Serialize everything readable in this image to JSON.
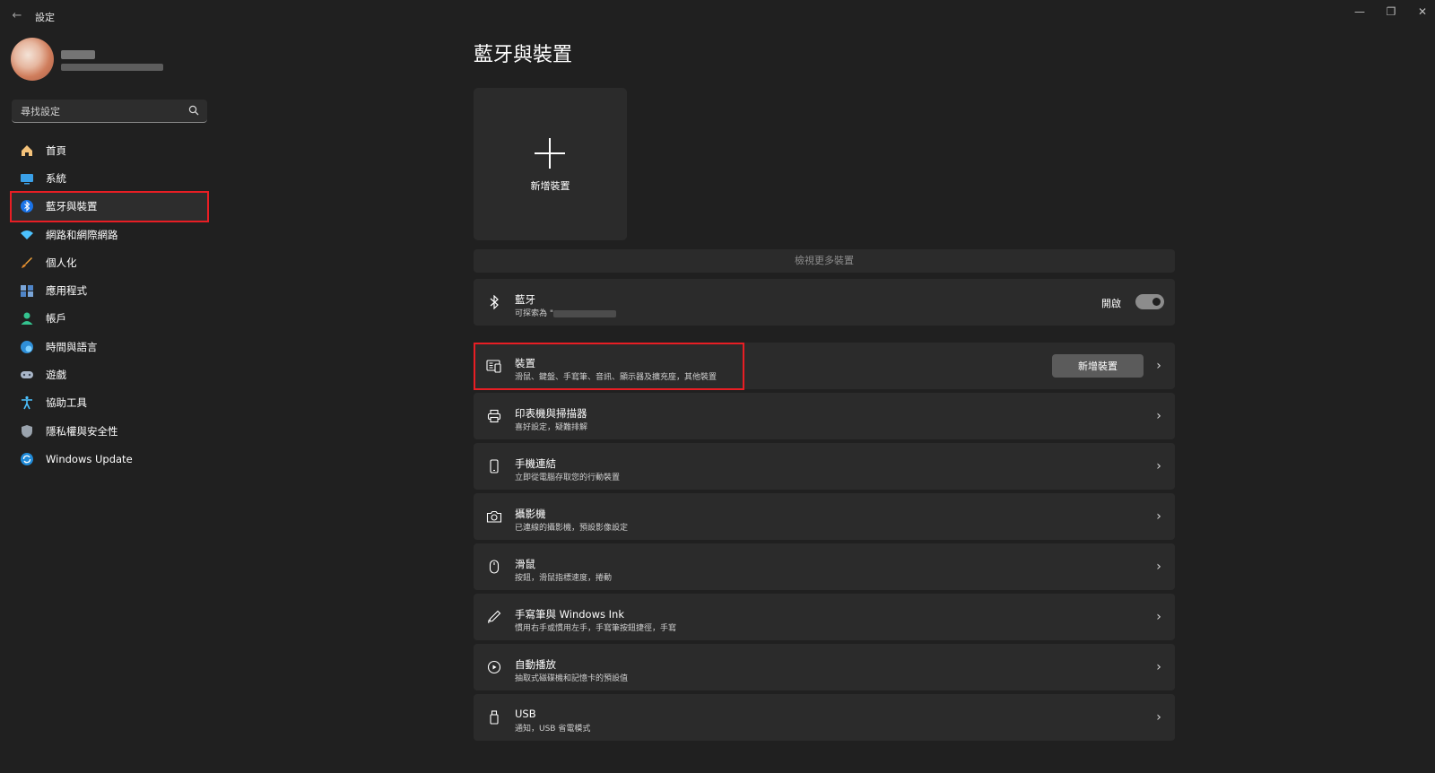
{
  "window": {
    "title": "設定",
    "controls": {
      "minimize": "—",
      "maximize": "❐",
      "close": "✕"
    }
  },
  "search": {
    "placeholder": "尋找設定"
  },
  "sidebar": {
    "items": [
      {
        "label": "首頁",
        "icon": "home-icon"
      },
      {
        "label": "系統",
        "icon": "system-icon"
      },
      {
        "label": "藍牙與裝置",
        "icon": "bluetooth-icon",
        "selected": true
      },
      {
        "label": "網路和網際網路",
        "icon": "wifi-icon"
      },
      {
        "label": "個人化",
        "icon": "brush-icon"
      },
      {
        "label": "應用程式",
        "icon": "apps-icon"
      },
      {
        "label": "帳戶",
        "icon": "account-icon"
      },
      {
        "label": "時間與語言",
        "icon": "globe-clock-icon"
      },
      {
        "label": "遊戲",
        "icon": "gamepad-icon"
      },
      {
        "label": "協助工具",
        "icon": "accessibility-icon"
      },
      {
        "label": "隱私權與安全性",
        "icon": "shield-icon"
      },
      {
        "label": "Windows Update",
        "icon": "update-icon"
      }
    ]
  },
  "main": {
    "title": "藍牙與裝置",
    "add_tile_label": "新增裝置",
    "more_devices": "檢視更多裝置",
    "bluetooth": {
      "title": "藍牙",
      "subtitle_prefix": "可探索為 \"",
      "toggle_label": "開啟",
      "toggle_on": true
    },
    "cards": [
      {
        "title": "裝置",
        "subtitle": "滑鼠、鍵盤、手寫筆、音訊、顯示器及擴充座，其他裝置",
        "button": "新增裝置",
        "icon": "devices-icon"
      },
      {
        "title": "印表機與掃描器",
        "subtitle": "喜好設定，疑難排解",
        "icon": "printer-icon"
      },
      {
        "title": "手機連結",
        "subtitle": "立即從電腦存取您的行動裝置",
        "icon": "phone-icon"
      },
      {
        "title": "攝影機",
        "subtitle": "已連線的攝影機，預設影像設定",
        "icon": "camera-icon"
      },
      {
        "title": "滑鼠",
        "subtitle": "按鈕，滑鼠指標速度，捲動",
        "icon": "mouse-icon"
      },
      {
        "title": "手寫筆與 Windows Ink",
        "subtitle": "慣用右手或慣用左手，手寫筆按鈕捷徑，手寫",
        "icon": "pen-icon"
      },
      {
        "title": "自動播放",
        "subtitle": "抽取式磁碟機和記憶卡的預設值",
        "icon": "autoplay-icon"
      },
      {
        "title": "USB",
        "subtitle": "通知，USB 省電模式",
        "icon": "usb-icon"
      }
    ]
  },
  "colors": {
    "background": "#202020",
    "card": "#2b2b2b",
    "highlight": "#e81e24",
    "accent": "#4cc2ff"
  }
}
